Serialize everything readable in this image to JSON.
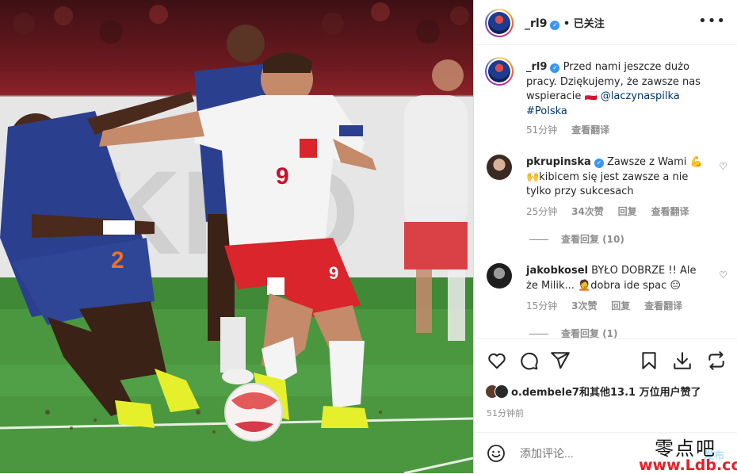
{
  "header": {
    "username": "_rl9",
    "follow_status": "• 已关注",
    "more_icon": "more-dots-icon"
  },
  "caption": {
    "username": "_rl9",
    "line1": "Przed nami jeszcze dużo",
    "line2": "pracy. Dziękujemy, że zawsze nas",
    "line3_prefix": "wspieracie 🇵🇱 ",
    "mention": "@laczynaspilka",
    "hashtag": "#Polska",
    "time": "51分钟",
    "translate": "查看翻译"
  },
  "comments": [
    {
      "username": "pkrupinska",
      "line1": "Zawsze z Wami 💪",
      "line2": "🙌kibicem się jest zawsze a nie",
      "line3": "tylko przy sukcesach",
      "time": "25分钟",
      "likes": "34次赞",
      "reply": "回复",
      "translate": "查看翻译",
      "view_replies": "查看回复 (10)"
    },
    {
      "username": "jakobkosel",
      "line1": "BYŁO DOBRZE !! Ale",
      "line2": "że Milik... 🤦dobra ide spac 😐",
      "time": "15分钟",
      "likes": "3次赞",
      "reply": "回复",
      "translate": "查看翻译",
      "view_replies": "查看回复 (1)"
    }
  ],
  "actions": {
    "icons": [
      "heart-icon",
      "comment-icon",
      "share-icon",
      "bookmark-icon",
      "download-icon",
      "repost-icon"
    ]
  },
  "likes": {
    "text": "o.dembele7和其他13.1 万位用户赞了"
  },
  "post_time": "51分钟前",
  "comment_box": {
    "placeholder": "添加评论...",
    "post_label": "发布"
  },
  "watermark": {
    "line1": "零点吧",
    "line2": "www.Ldb.cc"
  },
  "colors": {
    "verified": "#3897f0",
    "link": "#00376b",
    "muted": "#8e8e8e",
    "poland_red": "#d9252b",
    "netherlands_blue": "#2b3f8f"
  }
}
